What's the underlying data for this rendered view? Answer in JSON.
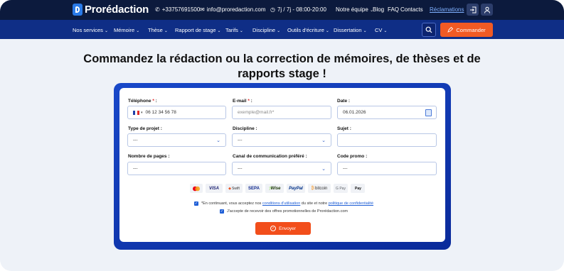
{
  "brand": {
    "name": "Prorédaction",
    "accent": "#f15a24",
    "navy": "#0c1a3d",
    "blue": "#0f2e86"
  },
  "topbar": {
    "phone": "+33757691500",
    "email": "info@proredaction.com",
    "hours": "7j / 7j - 08:00-20:00",
    "links": [
      "Notre équipe",
      "Blog",
      "FAQ",
      "Contacts"
    ],
    "reclamations": "Réclamations"
  },
  "nav": {
    "items": [
      "Nos services",
      "Mémoire",
      "Thèse",
      "Rapport de stage",
      "Tarifs",
      "Discipline",
      "Outils d'écriture",
      "Dissertation",
      "CV"
    ],
    "order_button": "Commander"
  },
  "heading": "Commandez la rédaction ou la correction de mémoires, de thèses et de rapports stage !",
  "form": {
    "phone": {
      "label": "Téléphone",
      "required": "*",
      "value": "06 12 34 56 78"
    },
    "email": {
      "label": "E-mail",
      "required": "*",
      "placeholder": "exemple@mail.fr*"
    },
    "date": {
      "label": "Date :",
      "value": "06.01.2026"
    },
    "project_type": {
      "label": "Type de projet :",
      "value": "---"
    },
    "discipline": {
      "label": "Discipline :",
      "value": "---"
    },
    "subject": {
      "label": "Sujet :",
      "value": ""
    },
    "pages": {
      "label": "Nombre de pages :",
      "value": "---"
    },
    "channel": {
      "label": "Canal de communication préféré :",
      "value": "---"
    },
    "promo": {
      "label": "Code promo :",
      "value": "---"
    }
  },
  "payments": [
    "VISA",
    "Swift",
    "SEPA",
    "Wise",
    "PayPal",
    "bitcoin",
    "G Pay",
    "Pay"
  ],
  "consents": {
    "terms_prefix": "*En continuant, vous acceptez nos",
    "terms_link": "conditions d'utilisation",
    "terms_mid": "du site et notre",
    "privacy_link": "politique de confidentialité",
    "promo_text": "J'accepte de recevoir des offres promotionnelles de Prorédaction.com"
  },
  "submit": "Envoyer"
}
